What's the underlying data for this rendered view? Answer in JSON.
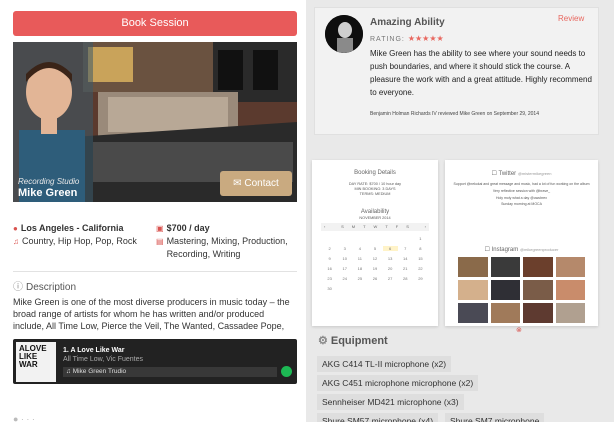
{
  "book_button": "Book Session",
  "profile": {
    "photo_subtitle": "Recording Studio",
    "name": "Mike Green",
    "contact_button": "Contact"
  },
  "details": {
    "location": "Los Angeles - California",
    "genres": "Country, Hip Hop, Pop, Rock",
    "price": "$700 / day",
    "services": "Mastering, Mixing, Production, Recording, Writing"
  },
  "description": {
    "heading": "Description",
    "text": "Mike Green is one of the most diverse producers in music today – the broad range of artists for whom he has written and/or produced include, All Time Low, Pierce the Veil, The Wanted, Cassadee Pope,"
  },
  "player": {
    "album_text": "ALOVE LIKE WAR",
    "track_title": "1. A Love Like War",
    "track_artist": "All Time Low, Vic Fuentes",
    "playlist": "Mike Green Trudio"
  },
  "review": {
    "title": "Amazing Ability",
    "rating_label": "RATING:",
    "stars": "★★★★★",
    "review_button": "Review",
    "text": "Mike Green has the ability to see where your sound needs to push boundaries, and where it should stick the course. A pleasure the work with and a great attitude. Highly recommend to everyone.",
    "footer": "Benjamin Holman Richards IV reviewed Mike Green on September 29, 2014"
  },
  "booking": {
    "heading": "Booking Details",
    "day_rate": "DAY RATE: $700 / 10 hour day",
    "min_booking": "MIN BOOKING: 3 DAYS",
    "terms": "TERMS: MEDIUM",
    "availability": "Availability",
    "month": "NOVEMBER 2014",
    "weekdays": [
      "S",
      "M",
      "T",
      "W",
      "T",
      "F",
      "S"
    ],
    "days": [
      "",
      "",
      "",
      "",
      "",
      "",
      "1",
      "2",
      "3",
      "4",
      "5",
      "6",
      "7",
      "8",
      "9",
      "10",
      "11",
      "12",
      "13",
      "14",
      "15",
      "16",
      "17",
      "18",
      "19",
      "20",
      "21",
      "22",
      "23",
      "24",
      "25",
      "26",
      "27",
      "28",
      "29",
      "30",
      "",
      "",
      "",
      "",
      "",
      ""
    ]
  },
  "social": {
    "twitter_heading": "Twitter",
    "twitter_handle": "@mistermikegreen",
    "tweets": [
      "Support @nekokai and great message and music, had a lot of fun working on the album",
      "Very reflective session with @brave_",
      "Holy moly what a day @uwubrex",
      "Sunday morning at MOCA"
    ],
    "instagram_heading": "Instagram",
    "instagram_handle": "@mikegreenproducer",
    "photo_colors": [
      "#8a6a4a",
      "#3a3a3a",
      "#6b3f2c",
      "#b5896b",
      "#d4b08c",
      "#2f2f35",
      "#7a5c48",
      "#c98c6b",
      "#4a4a55",
      "#a07a5a",
      "#5e3a30",
      "#b0a090"
    ]
  },
  "equipment": {
    "heading": "Equipment",
    "items": [
      "AKG C414 TL-II microphone (x2)",
      "AKG C451 microphone microphone (x2)",
      "Sennheiser MD421 microphone (x3)",
      "Shure SM57 microphone (x4)",
      "Shure SM7 microphone"
    ]
  }
}
